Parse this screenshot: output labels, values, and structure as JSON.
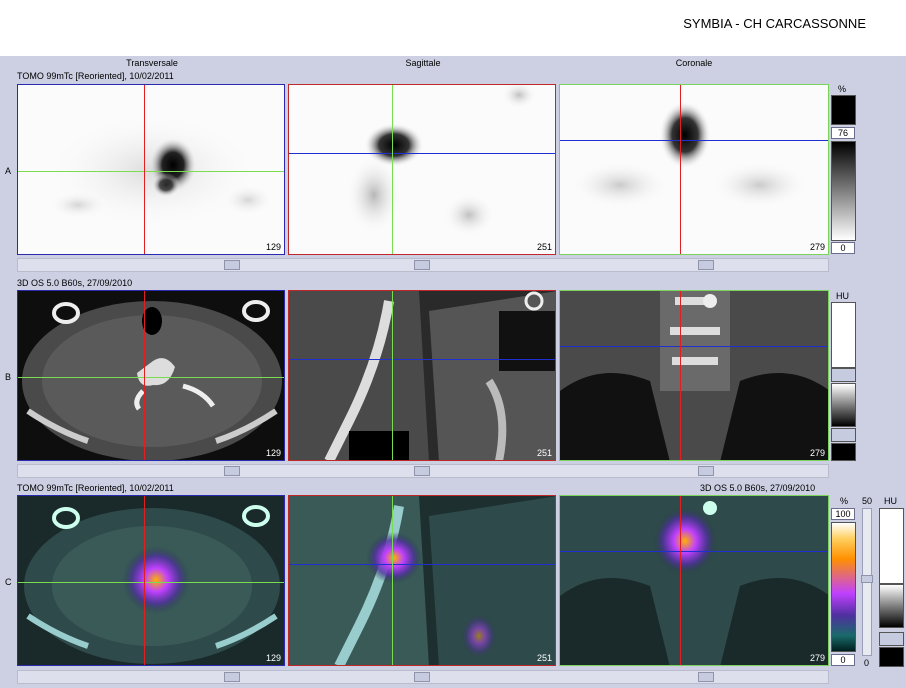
{
  "header": {
    "title": "SYMBIA - CH CARCASSONNE"
  },
  "view_headers": {
    "transverse": "Transversale",
    "sagittal": "Sagittale",
    "coronal": "Coronale"
  },
  "rows": {
    "a": {
      "letter": "A",
      "series_label": "TOMO 99mTc [Reoriented], 10/02/2011",
      "slices": {
        "transverse": "129",
        "sagittal": "251",
        "coronal": "279"
      },
      "colorbar": {
        "unit": "%",
        "upper": "76",
        "lower": "0"
      }
    },
    "b": {
      "letter": "B",
      "series_label": "3D  OS  5.0  B60s, 27/09/2010",
      "slices": {
        "transverse": "129",
        "sagittal": "251",
        "coronal": "279"
      },
      "colorbar": {
        "unit": "HU"
      }
    },
    "c": {
      "letter": "C",
      "series_label_left": "TOMO 99mTc [Reoriented], 10/02/2011",
      "series_label_right": "3D  OS  5.0  B60s, 27/09/2010",
      "slices": {
        "transverse": "129",
        "sagittal": "251",
        "coronal": "279"
      },
      "colorbar_pct": {
        "unit": "%",
        "upper": "100",
        "lower": "0"
      },
      "blend": {
        "upper": "50",
        "lower": "0"
      },
      "colorbar_hu": {
        "unit": "HU"
      }
    }
  },
  "colors": {
    "red_cursor": "#e02020",
    "green_cursor": "#7adc50",
    "blue_cursor": "#2030d0",
    "panel_bg": "#ccd0e2"
  }
}
